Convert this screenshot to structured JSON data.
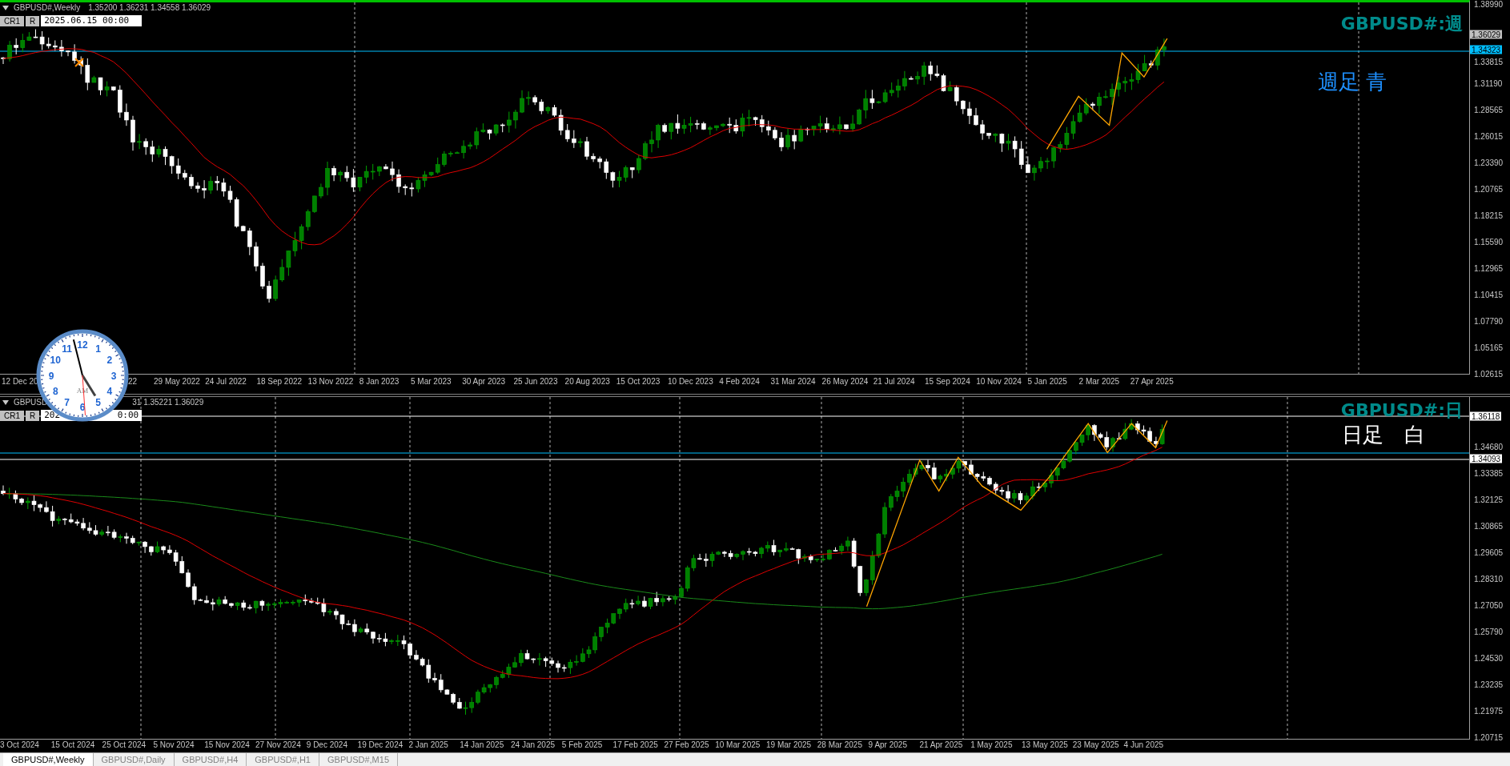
{
  "weekly_chart": {
    "header": {
      "symbol": "GBPUSD#,Weekly",
      "ohlc": "1.35200 1.36231 1.34558 1.36029"
    },
    "buttons": [
      "CR1",
      "R"
    ],
    "datetime": [
      "2025.06.15 00:00"
    ],
    "title": "GBPUSD#:週",
    "note": "週足 青",
    "price_axis": [
      "1.38990",
      "1.33815",
      "1.31190",
      "1.28565",
      "1.26015",
      "1.23390",
      "1.20765",
      "1.18215",
      "1.15590",
      "1.12965",
      "1.10415",
      "1.07790",
      "1.05165",
      "1.02615"
    ],
    "price_markers": [
      {
        "label": "1.36029",
        "kind": "bid"
      },
      {
        "label": "1.34323",
        "kind": "alert"
      }
    ],
    "time_axis": [
      "12 Dec 20",
      "22",
      "29 May 2022",
      "24 Jul 2022",
      "18 Sep 2022",
      "13 Nov 2022",
      "8 Jan 2023",
      "5 Mar 2023",
      "30 Apr 2023",
      "25 Jun 2023",
      "20 Aug 2023",
      "15 Oct 2023",
      "10 Dec 2023",
      "4 Feb 2024",
      "31 Mar 2024",
      "26 May 2024",
      "21 Jul 2024",
      "15 Sep 2024",
      "10 Nov 2024",
      "5 Jan 2025",
      "2 Mar 2025",
      "27 Apr 2025"
    ]
  },
  "daily_chart": {
    "header": {
      "symbol": "GBPUSD",
      "ohlc": "31 1.35221 1.36029"
    },
    "buttons": [
      "CR1",
      "R"
    ],
    "datetime": [
      "202",
      "0:00"
    ],
    "title": "GBPUSD#:日",
    "note": "日足　白",
    "price_axis": [
      "1.34680",
      "1.33385",
      "1.32125",
      "1.30865",
      "1.29605",
      "1.28310",
      "1.27050",
      "1.25790",
      "1.24530",
      "1.23235",
      "1.21975",
      "1.20715"
    ],
    "price_markers": [
      {
        "label": "1.36118",
        "kind": "line"
      },
      {
        "label": "1.34093",
        "kind": "line"
      }
    ],
    "time_axis": [
      "3 Oct 2024",
      "15 Oct 2024",
      "25 Oct 2024",
      "5 Nov 2024",
      "15 Nov 2024",
      "27 Nov 2024",
      "9 Dec 2024",
      "19 Dec 2024",
      "2 Jan 2025",
      "14 Jan 2025",
      "24 Jan 2025",
      "5 Feb 2025",
      "17 Feb 2025",
      "27 Feb 2025",
      "10 Mar 2025",
      "19 Mar 2025",
      "28 Mar 2025",
      "9 Apr 2025",
      "21 Apr 2025",
      "1 May 2025",
      "13 May 2025",
      "23 May 2025",
      "4 Jun 2025"
    ]
  },
  "clock": {
    "numbers": [
      "12",
      "11",
      "1",
      "10",
      "2",
      "9",
      "3",
      "8",
      "4",
      "7",
      "5",
      "6"
    ],
    "period": "AM"
  },
  "tabs": [
    {
      "label": "GBPUSD#,Weekly",
      "selected": true
    },
    {
      "label": "GBPUSD#,Daily",
      "selected": false
    },
    {
      "label": "GBPUSD#,H4",
      "selected": false
    },
    {
      "label": "GBPUSD#,H1",
      "selected": false
    },
    {
      "label": "GBPUSD#,M15",
      "selected": false
    }
  ]
}
